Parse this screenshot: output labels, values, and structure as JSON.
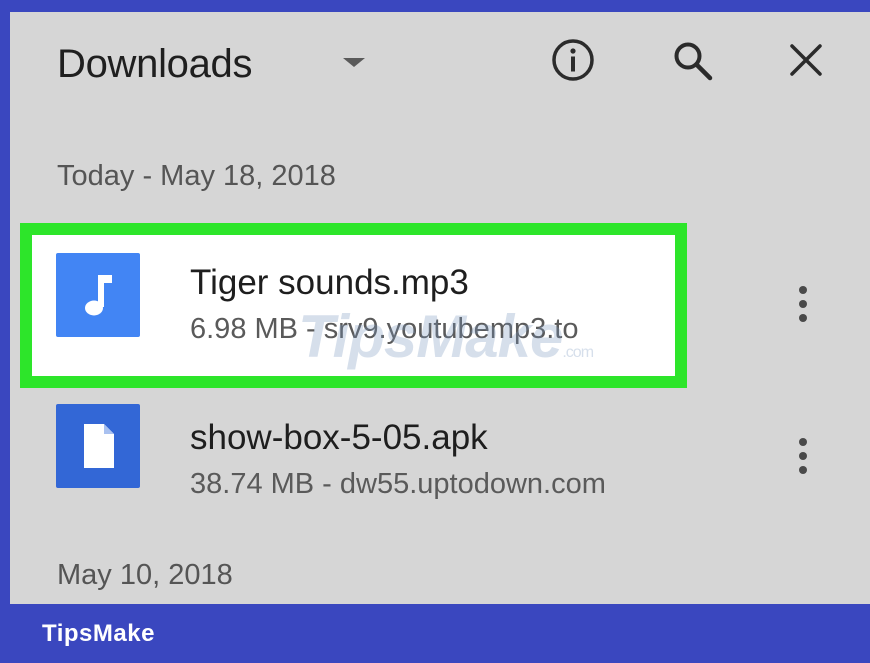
{
  "header": {
    "title": "Downloads",
    "dropdown_icon": "caret-down-icon",
    "actions": [
      {
        "name": "info-icon"
      },
      {
        "name": "search-icon"
      },
      {
        "name": "close-icon"
      }
    ]
  },
  "sections": [
    {
      "label": "Today - May 18, 2018",
      "items": [
        {
          "icon": "music-note-icon",
          "icon_color": "#4285f4",
          "name": "Tiger sounds.mp3",
          "meta": "6.98 MB - srv9.youtubemp3.to",
          "highlighted": true,
          "highlight_color": "#2de52a"
        },
        {
          "icon": "document-icon",
          "icon_color": "#3367d6",
          "name": "show-box-5-05.apk",
          "meta": "38.74 MB - dw55.uptodown.com",
          "highlighted": false
        }
      ]
    },
    {
      "label": "May 10, 2018",
      "items": []
    }
  ],
  "watermark": {
    "text": "TipsMake",
    "suffix": ".com"
  },
  "brand": {
    "text": "TipsMake",
    "color": "#3a47bf"
  }
}
